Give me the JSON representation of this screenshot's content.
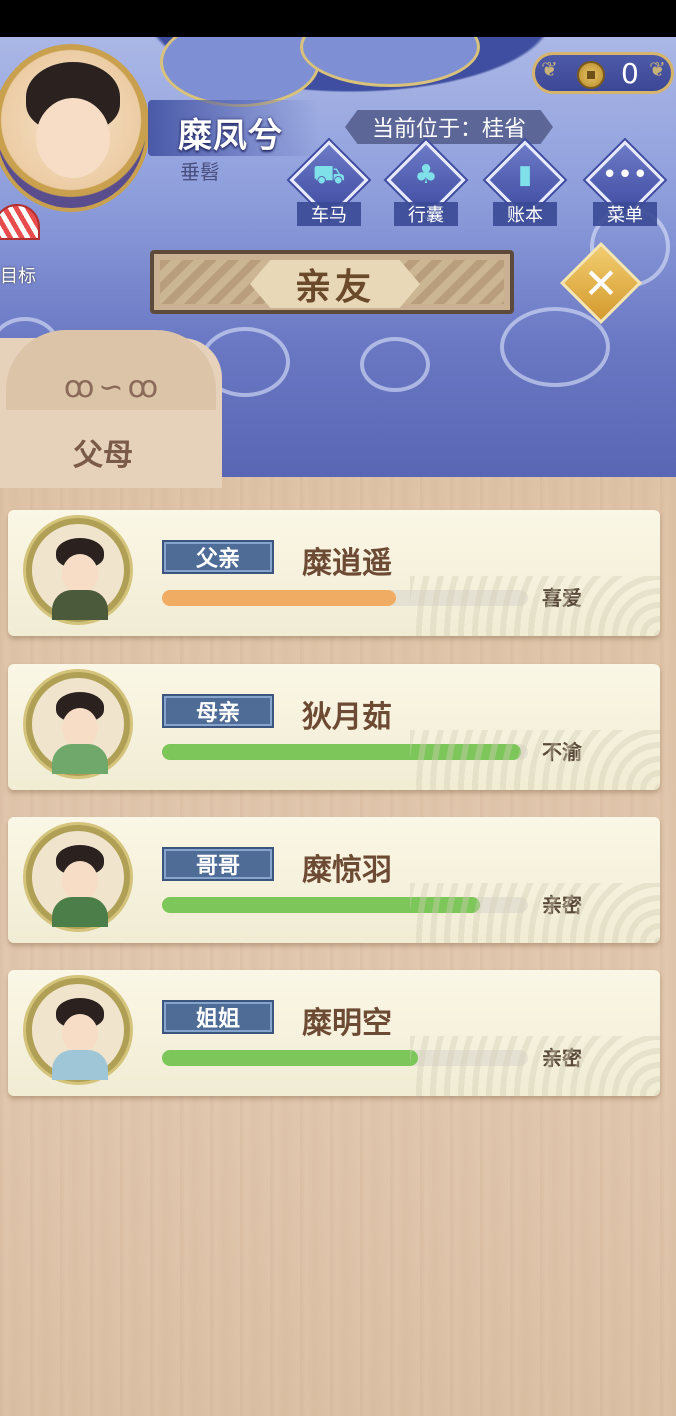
{
  "player": {
    "name": "糜凤兮",
    "title": "垂髫",
    "location": "当前位于：桂省",
    "coins": "0"
  },
  "nav": [
    {
      "label": "车马",
      "icon": "carriage-icon"
    },
    {
      "label": "行囊",
      "icon": "bag-icon"
    },
    {
      "label": "账本",
      "icon": "ledger-icon"
    },
    {
      "label": "菜单",
      "icon": "menu-icon"
    }
  ],
  "goal_label": "目标",
  "section_title": "亲友",
  "tab_label": "父母",
  "relatives": [
    {
      "relation": "父亲",
      "name": "糜逍遥",
      "affinity": 0.64,
      "mood": "喜爱",
      "bar_color": "#f1ac63",
      "outfit": "#4a5a3a"
    },
    {
      "relation": "母亲",
      "name": "狄月茹",
      "affinity": 0.98,
      "mood": "不渝",
      "bar_color": "#7cc65a",
      "outfit": "#6fa86a"
    },
    {
      "relation": "哥哥",
      "name": "糜惊羽",
      "affinity": 0.87,
      "mood": "亲密",
      "bar_color": "#7cc65a",
      "outfit": "#4c7e4a"
    },
    {
      "relation": "姐姐",
      "name": "糜明空",
      "affinity": 0.7,
      "mood": "亲密",
      "bar_color": "#7cc65a",
      "outfit": "#9fc6d6"
    }
  ],
  "colors": {
    "sky": "#6a78c4",
    "accent_gold": "#c9a04e",
    "relation_tag": "#4f6c97",
    "wood": "#e0c7ae"
  }
}
